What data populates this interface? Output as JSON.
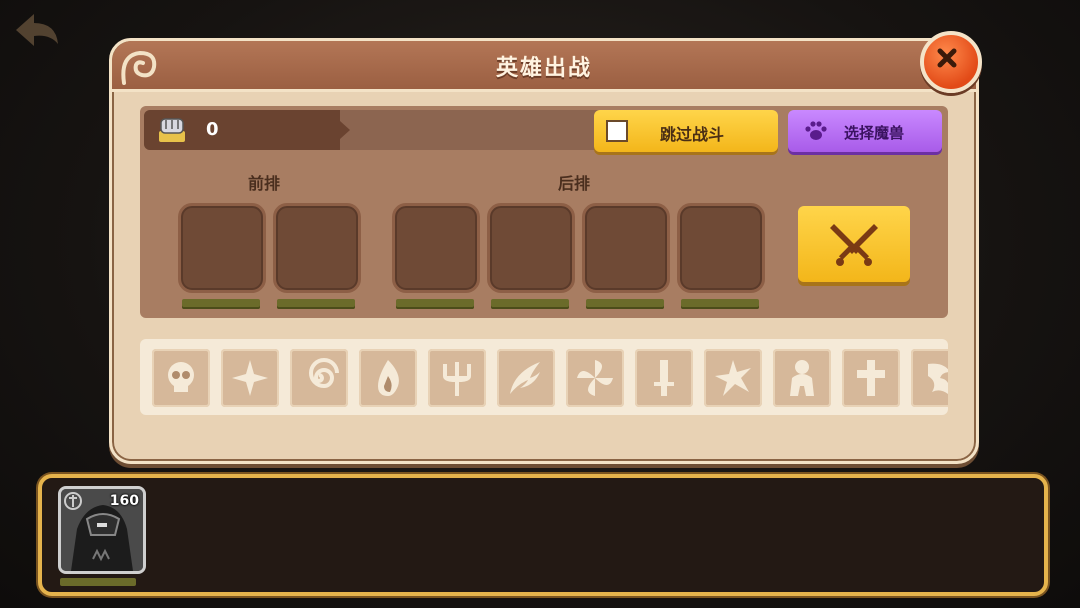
{
  "dialog": {
    "title": "英雄出战",
    "close_icon": "close-icon"
  },
  "formation": {
    "count": "0",
    "skip_battle_label": "跳过战斗",
    "select_beast_label": "选择魔兽",
    "front_row_label": "前排",
    "back_row_label": "后排",
    "front_slots": 2,
    "back_slots": 4
  },
  "filters": {
    "icons": [
      "skull-icon",
      "cross-icon",
      "spiral-icon",
      "flame-icon",
      "trident-icon",
      "wings-icon",
      "pinwheel-icon",
      "sword-icon",
      "burst-icon",
      "figure-icon",
      "holy-cross-icon",
      "dragon-icon"
    ]
  },
  "tray": {
    "heroes": [
      {
        "level": "160",
        "icon": "dark-knight-portrait"
      }
    ]
  },
  "colors": {
    "accent_yellow": "#f3b61a",
    "accent_purple": "#a85be9",
    "close_red": "#e24a17",
    "panel_brown": "#a87d62"
  }
}
